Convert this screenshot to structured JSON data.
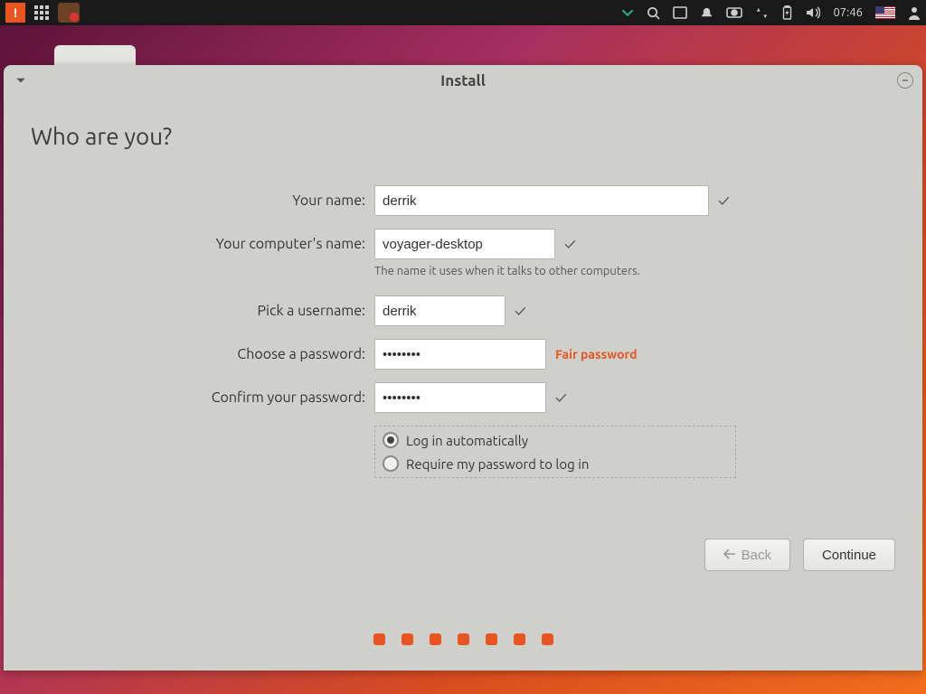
{
  "panel": {
    "time": "07:46"
  },
  "window": {
    "title": "Install",
    "heading": "Who are you?",
    "labels": {
      "name": "Your name:",
      "computer": "Your computer's name:",
      "computer_helper": "The name it uses when it talks to other computers.",
      "username": "Pick a username:",
      "password": "Choose a password:",
      "confirm": "Confirm your password:"
    },
    "values": {
      "name": "derrik",
      "computer": "voyager-desktop",
      "username": "derrik",
      "password": "••••••••",
      "confirm": "••••••••"
    },
    "password_strength": "Fair password",
    "login_options": {
      "auto": "Log in automatically",
      "require": "Require my password to log in",
      "selected": "auto"
    },
    "buttons": {
      "back": "Back",
      "continue": "Continue"
    }
  }
}
